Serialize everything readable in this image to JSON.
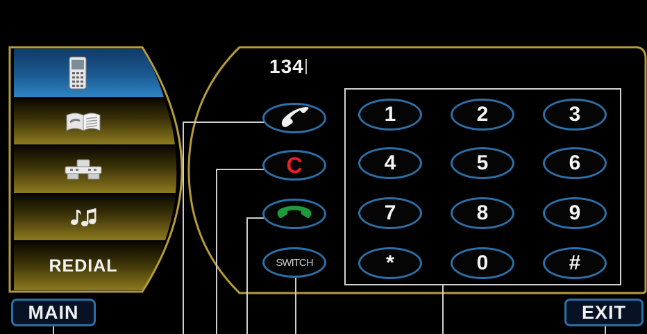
{
  "display": {
    "number": "134"
  },
  "menu": {
    "items": [
      {
        "icon": "phone-icon",
        "selected": true
      },
      {
        "icon": "phonebook-icon"
      },
      {
        "icon": "call-log-icon"
      },
      {
        "icon": "music-icon"
      },
      {
        "label": "REDIAL"
      }
    ]
  },
  "call_buttons": {
    "c_label": "C",
    "switch_label": "SWITCH"
  },
  "keypad": {
    "keys": [
      "1",
      "2",
      "3",
      "4",
      "5",
      "6",
      "7",
      "8",
      "9",
      "*",
      "0",
      "#"
    ]
  },
  "bottom": {
    "main_label": "MAIN",
    "exit_label": "EXIT"
  },
  "colors": {
    "accent_blue": "#2d6fa6",
    "frame_gold": "#b59c3a",
    "menu_gold": "#8c7a1e",
    "selected_blue": "#1c5a92",
    "clear_red": "#e4202a",
    "call_green": "#1e9a3c"
  }
}
